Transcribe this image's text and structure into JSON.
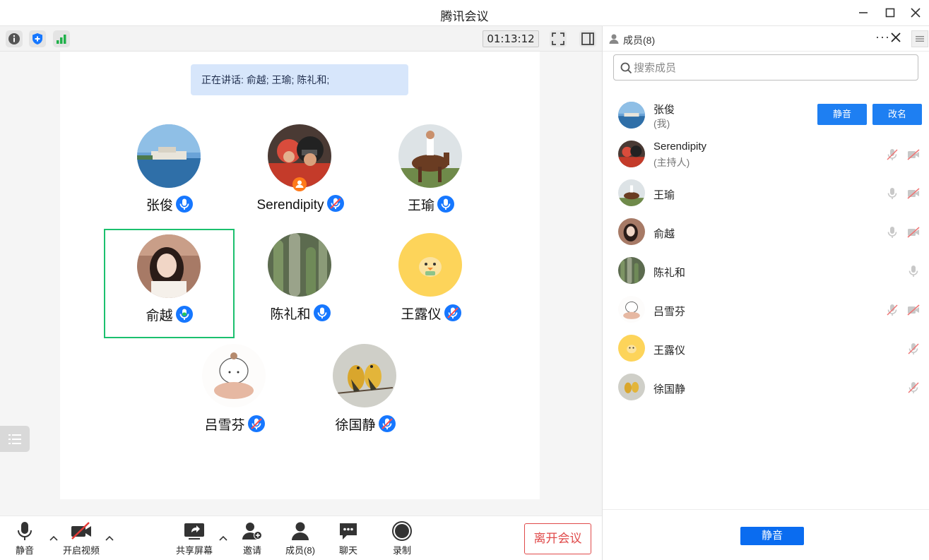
{
  "window": {
    "title": "腾讯会议"
  },
  "info_bar": {
    "timer": "01:13:12"
  },
  "speaking": {
    "text": "正在讲话: 俞越; 王瑜; 陈礼和;"
  },
  "participants": [
    {
      "name": "张俊",
      "mic": "on",
      "avatar": "lake-photo"
    },
    {
      "name": "Serendipity",
      "mic": "muted",
      "avatar": "helmet-photo",
      "host": true
    },
    {
      "name": "王瑜",
      "mic": "on",
      "avatar": "horse-rider-photo"
    },
    {
      "name": "俞越",
      "mic": "speaking",
      "avatar": "girl-photo",
      "active": true
    },
    {
      "name": "陈礼和",
      "mic": "on",
      "avatar": "cactus-photo"
    },
    {
      "name": "王露仪",
      "mic": "muted",
      "avatar": "chick-cartoon"
    },
    {
      "name": "吕雪芬",
      "mic": "muted",
      "avatar": "girl-sketch"
    },
    {
      "name": "徐国静",
      "mic": "muted",
      "avatar": "birds-painting"
    }
  ],
  "toolbar": {
    "mute": "静音",
    "video": "开启视频",
    "share": "共享屏幕",
    "invite": "邀请",
    "members": "成员(8)",
    "chat": "聊天",
    "record": "录制",
    "leave": "离开会议"
  },
  "panel": {
    "title": "成员(8)",
    "more": "···",
    "search_placeholder": "搜索成员",
    "members": [
      {
        "name": "张俊",
        "sub": "(我)",
        "mic": "none",
        "video": "none"
      },
      {
        "name": "Serendipity",
        "sub": "(主持人)",
        "mic": "muted",
        "video": "off"
      },
      {
        "name": "王瑜",
        "sub": "",
        "mic": "on",
        "video": "off"
      },
      {
        "name": "俞越",
        "sub": "",
        "mic": "on",
        "video": "off"
      },
      {
        "name": "陈礼和",
        "sub": "",
        "mic": "on",
        "video": "none"
      },
      {
        "name": "吕雪芬",
        "sub": "",
        "mic": "muted",
        "video": "off"
      },
      {
        "name": "王露仪",
        "sub": "",
        "mic": "muted",
        "video": "none"
      },
      {
        "name": "徐国静",
        "sub": "",
        "mic": "muted",
        "video": "none"
      }
    ],
    "self_actions": {
      "mute": "静音",
      "rename": "改名"
    },
    "mute_all": "静音"
  },
  "colors": {
    "accent_blue": "#1e7ff2",
    "active_green": "#1bc06e",
    "leave_red": "#e04a4a",
    "mic_blue": "#1677ff"
  }
}
